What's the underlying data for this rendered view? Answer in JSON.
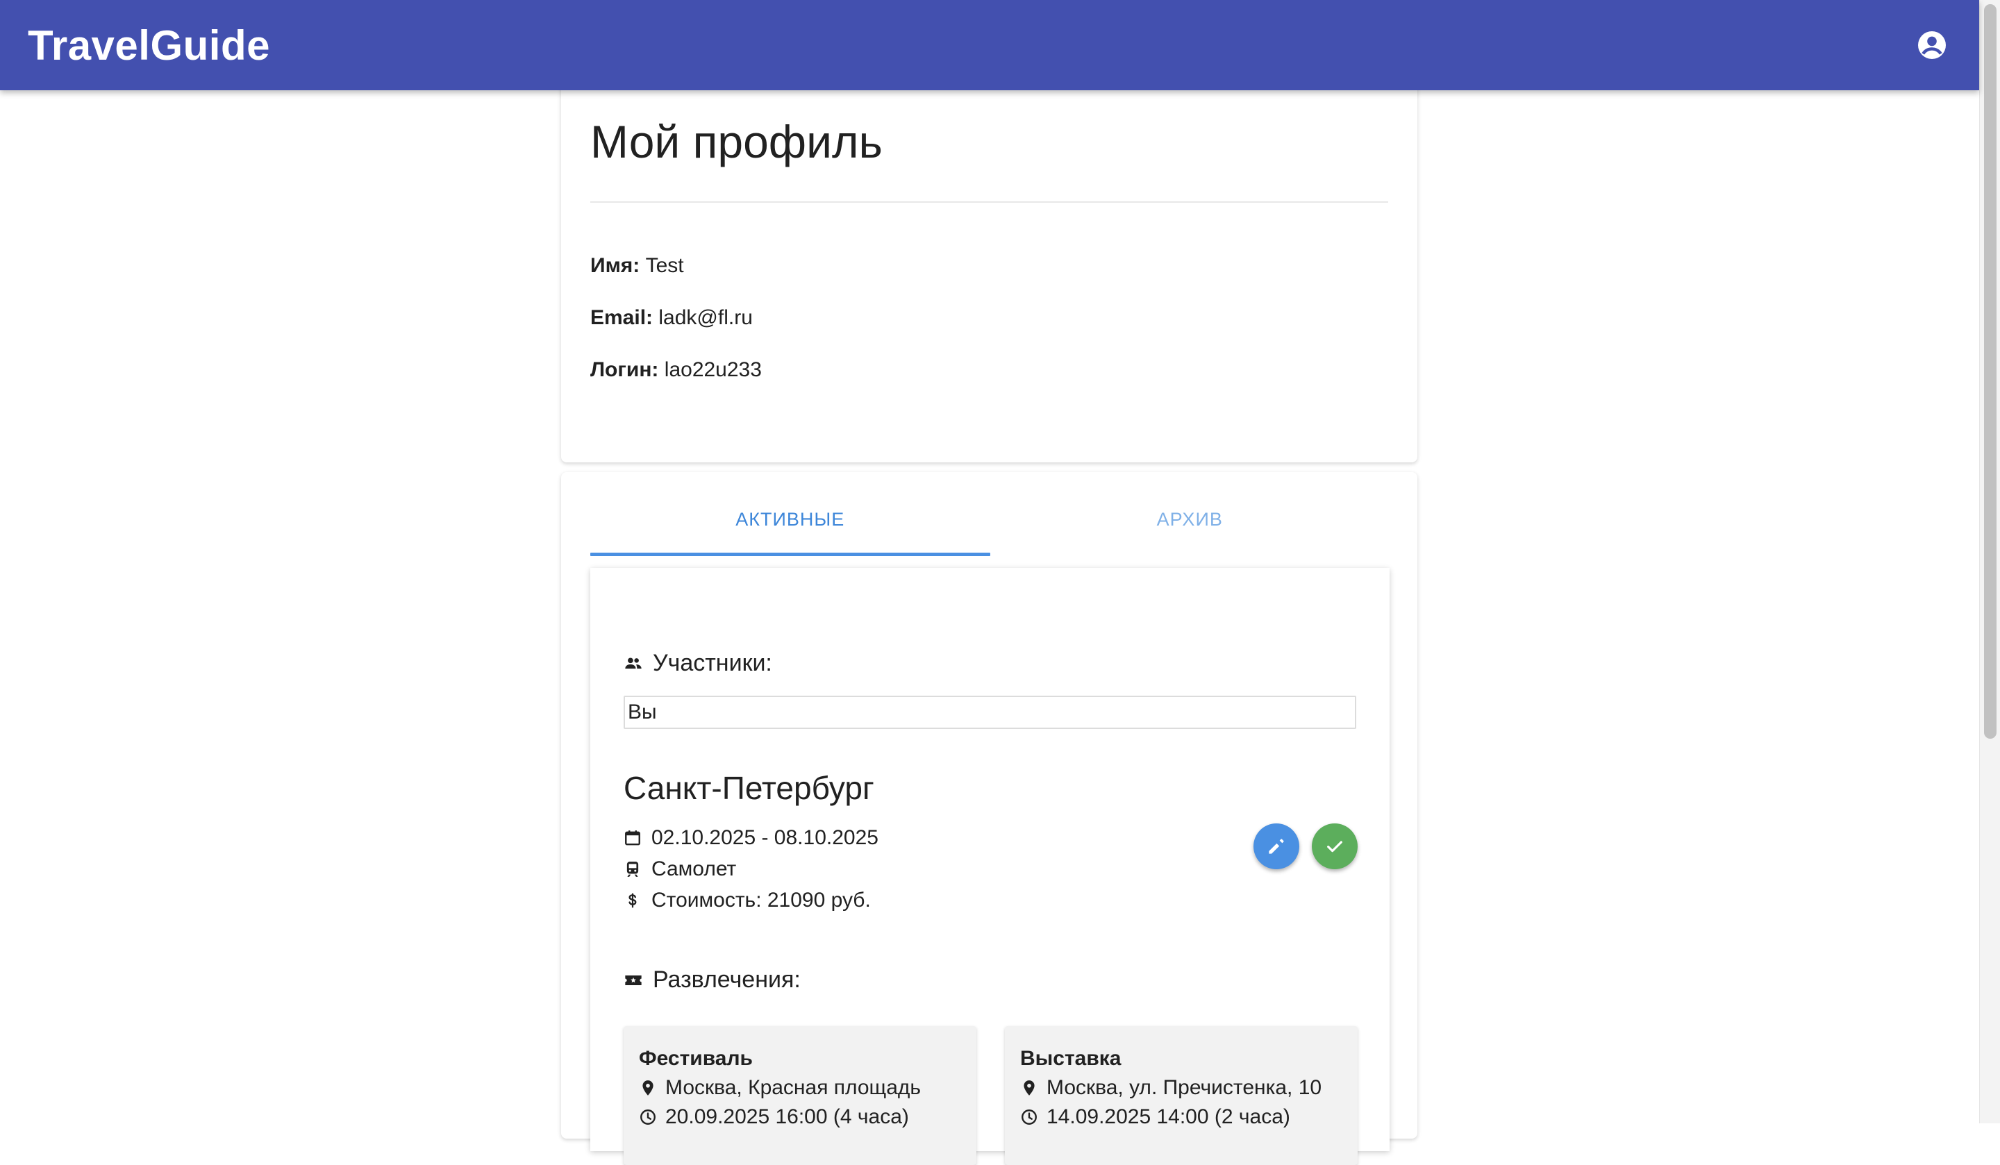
{
  "app": {
    "title": "TravelGuide",
    "account_icon": "account-circle-icon"
  },
  "profile": {
    "title": "Мой профиль",
    "fields": [
      {
        "label": "Имя:",
        "value": "Test"
      },
      {
        "label": "Email:",
        "value": "ladk@fl.ru"
      },
      {
        "label": "Логин:",
        "value": "lao22u233"
      }
    ]
  },
  "tabs": [
    {
      "label": "АКТИВНЫЕ",
      "active": true
    },
    {
      "label": "АРХИВ",
      "active": false
    }
  ],
  "trip": {
    "participants_label": "Участники:",
    "participants_value": "Вы",
    "city": "Санкт-Петербург",
    "dates": "02.10.2025 - 08.10.2025",
    "transport": "Самолет",
    "cost": "Стоимость: 21090 руб.",
    "entertainment_label": "Развлечения:",
    "entertainments": [
      {
        "title": "Фестиваль",
        "location": "Москва, Красная площадь",
        "time": "20.09.2025 16:00 (4 часа)"
      },
      {
        "title": "Выставка",
        "location": "Москва, ул. Пречистенка, 10",
        "time": "14.09.2025 14:00 (2 часа)"
      }
    ]
  },
  "colors": {
    "appbar": "#4350af",
    "accent": "#4a90e2",
    "success": "#5cae5c"
  }
}
